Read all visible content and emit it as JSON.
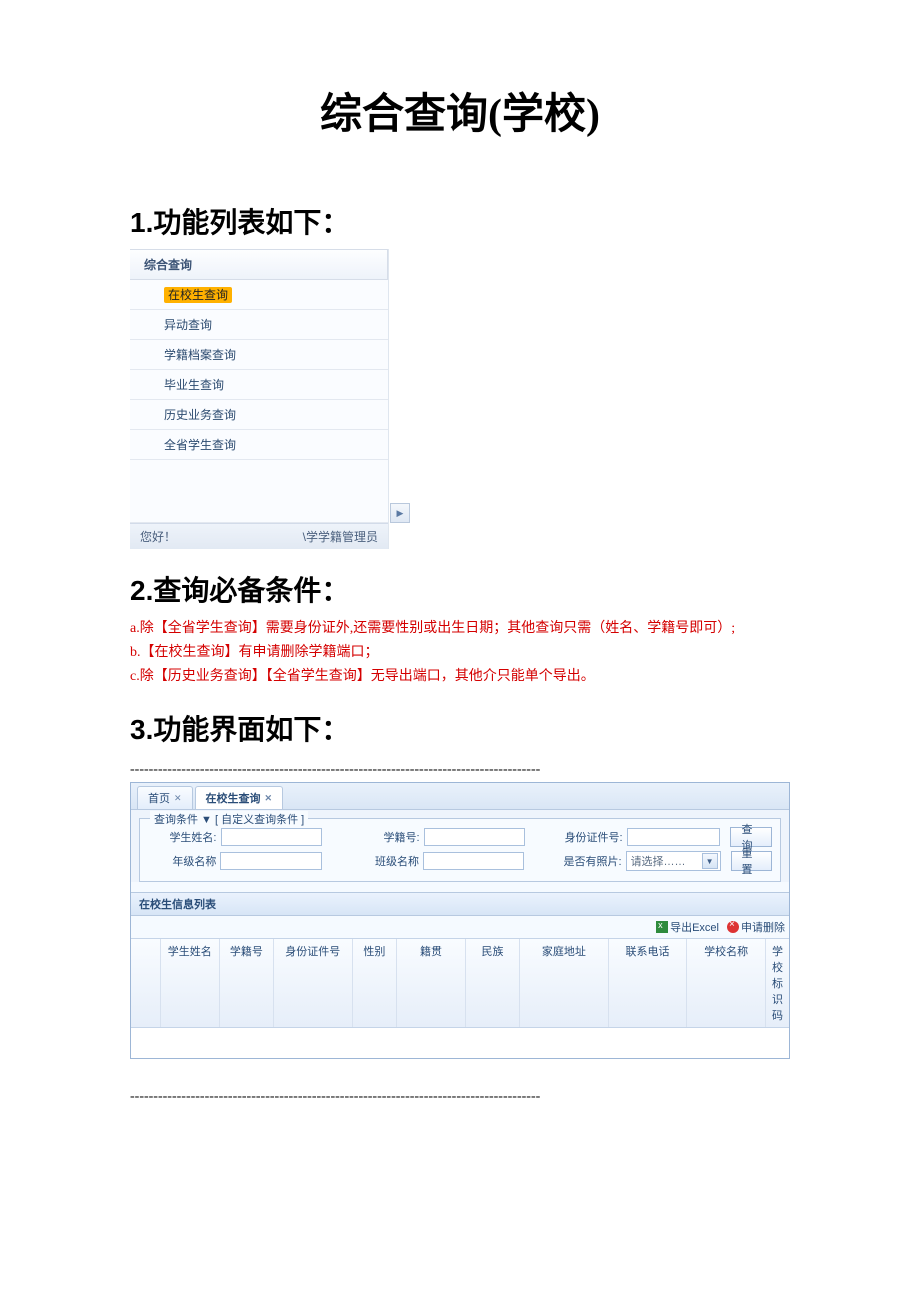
{
  "title": "综合查询(学校)",
  "sections": {
    "s1": "1.功能列表如下：",
    "s2": "2.查询必备条件：",
    "s3": "3.功能界面如下："
  },
  "sidebar": {
    "group": "综合查询",
    "items": [
      "在校生查询",
      "异动查询",
      "学籍档案查询",
      "毕业生查询",
      "历史业务查询",
      "全省学生查询"
    ],
    "status_left": "您好！",
    "status_right": "\\学学籍管理员"
  },
  "conditions": {
    "a": "a.除【全省学生查询】需要身份证外,还需要性别或出生日期；其他查询只需（姓名、学籍号即可）;",
    "b": "b.【在校生查询】有申请删除学籍端口；",
    "c": "c.除【历史业务查询】【全省学生查询】无导出端口，其他介只能单个导出。"
  },
  "divider": "----------------------------------------------------------------------------------------",
  "app": {
    "tabs": {
      "home": "首页",
      "active": "在校生查询"
    },
    "fieldset_legend": "查询条件 ▼ [ 自定义查询条件 ]",
    "labels": {
      "name": "学生姓名:",
      "code": "学籍号:",
      "id": "身份证件号:",
      "grade": "年级名称",
      "class": "班级名称",
      "photo": "是否有照片:"
    },
    "select_placeholder": "请选择……",
    "buttons": {
      "query": "查 询",
      "reset": "重 置"
    },
    "list_title": "在校生信息列表",
    "toolbar": {
      "excel": "导出Excel",
      "apply_del": "申请删除"
    },
    "columns": [
      "",
      "学生姓名",
      "学籍号",
      "身份证件号",
      "性别",
      "籍贯",
      "民族",
      "家庭地址",
      "联系电话",
      "学校名称",
      "学校标识码"
    ]
  }
}
